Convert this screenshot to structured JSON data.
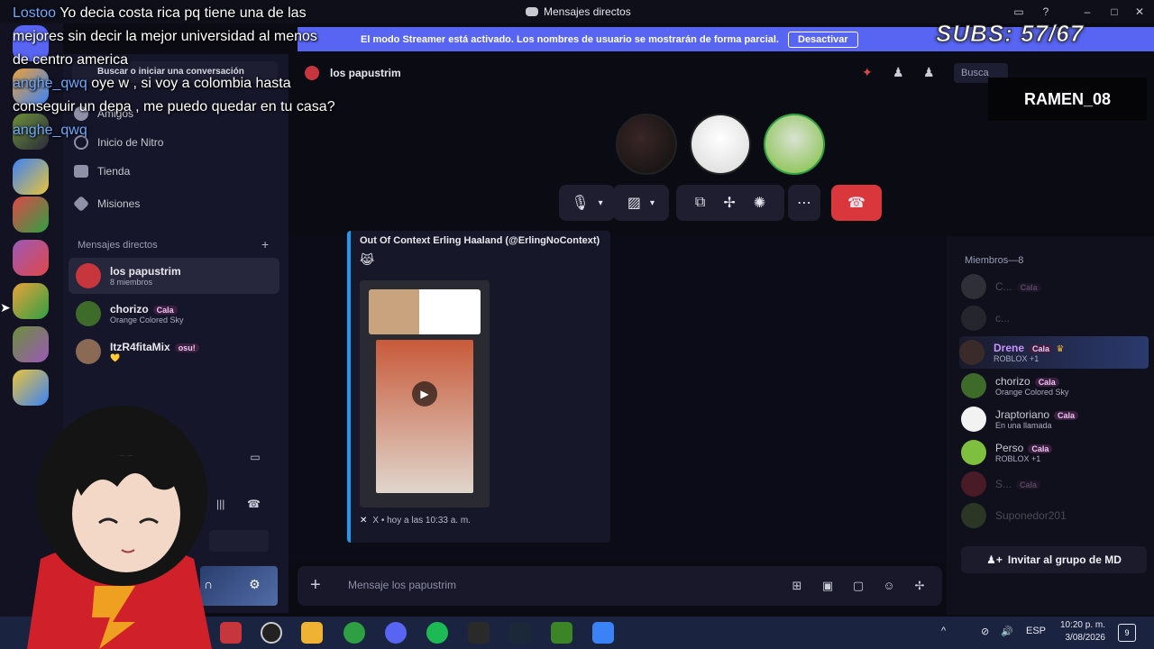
{
  "titlebar": {
    "title": "Mensajes directos"
  },
  "banner": {
    "text": "El modo Streamer está activado. Los nombres de usuario se mostrarán de forma parcial.",
    "button": "Desactivar"
  },
  "sidebar": {
    "search_placeholder": "Buscar o iniciar una conversación",
    "nav": [
      {
        "label": "Amigos",
        "icon": "friends-icon"
      },
      {
        "label": "Inicio de Nitro",
        "icon": "nitro-icon"
      },
      {
        "label": "Tienda",
        "icon": "shop-icon"
      },
      {
        "label": "Misiones",
        "icon": "quests-icon"
      }
    ],
    "dm_header": "Mensajes directos",
    "dms": [
      {
        "name": "los papustrim",
        "sub": "8 miembros"
      },
      {
        "name": "chorizo",
        "tag": "Cala",
        "sub": "Orange Colored Sky"
      },
      {
        "name": "ItzR4fitaMix",
        "tag": "osu!",
        "sub": "💛"
      }
    ]
  },
  "chat": {
    "header_title": "los papustrim",
    "search_placeholder": "Busca",
    "embed": {
      "author": "Out Of Context Erling Haaland (@ErlingNoContext)",
      "emoji": "😹",
      "footer": "X • hoy a las 10:33 a. m."
    },
    "composer_placeholder": "Mensaje los papustrim"
  },
  "members": {
    "header": "Miembros—8",
    "list": [
      {
        "name": "C...",
        "tag": "Cala",
        "sub": "",
        "dim": true
      },
      {
        "name": "c...",
        "tag": "",
        "sub": "",
        "dim": true
      },
      {
        "name": "Drene",
        "tag": "Cala",
        "sub": "ROBLOX +1",
        "dim": false
      },
      {
        "name": "chorizo",
        "tag": "Cala",
        "sub": "Orange Colored Sky",
        "dim": false
      },
      {
        "name": "Jraptoriano",
        "tag": "Cala",
        "sub": "En una llamada",
        "dim": false
      },
      {
        "name": "Perso",
        "tag": "Cala",
        "sub": "ROBLOX +1",
        "dim": false
      },
      {
        "name": "S...",
        "tag": "Cala",
        "sub": "",
        "dim": true
      },
      {
        "name": "Suponedor201",
        "tag": "",
        "sub": "",
        "dim": true
      }
    ],
    "invite": "Invitar al grupo de MD"
  },
  "overlay": {
    "messages": [
      {
        "user": "Lostoo",
        "text": "Yo decia costa rica pq tiene una de las mejores sin decir la mejor universidad al menos de centro america"
      },
      {
        "user": "anghe_qwq",
        "text": "oye w , si voy a colombia hasta conseguir un depa , me puedo quedar en tu casa?"
      },
      {
        "user": "anghe_qwq",
        "text": ""
      }
    ],
    "subs": "SUBS: 57/67",
    "ramen": "RAMEN_08"
  },
  "taskbar": {
    "lang": "ESP",
    "time": "10:20 p. m.",
    "date": "3/08/2026",
    "notifications": "9"
  },
  "colors": {
    "accent": "#5865f2",
    "hangup": "#da373c",
    "streamer_purple": "#5865f2"
  }
}
